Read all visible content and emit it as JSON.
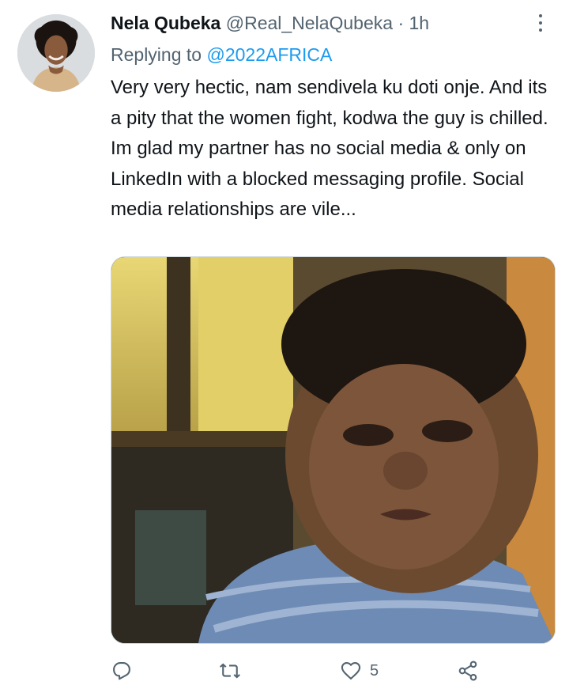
{
  "tweet": {
    "display_name": "Nela Qubeka",
    "handle": "@Real_NelaQubeka",
    "separator": "·",
    "time": "1h",
    "replying_label": "Replying to",
    "replying_to": "@2022AFRICA",
    "text": "Very very hectic, nam sendivela ku doti onje. And its a pity that the women fight, kodwa the guy is chilled. Im glad my partner has no social media & only on LinkedIn with a blocked messaging profile. Social media relationships are vile...",
    "like_count": "5"
  },
  "icons": {
    "more": "more-vertical-icon",
    "reply": "reply-icon",
    "retweet": "retweet-icon",
    "like": "heart-icon",
    "share": "share-icon"
  },
  "colors": {
    "text": "#0f1419",
    "secondary": "#536471",
    "accent": "#1d9bf0"
  }
}
